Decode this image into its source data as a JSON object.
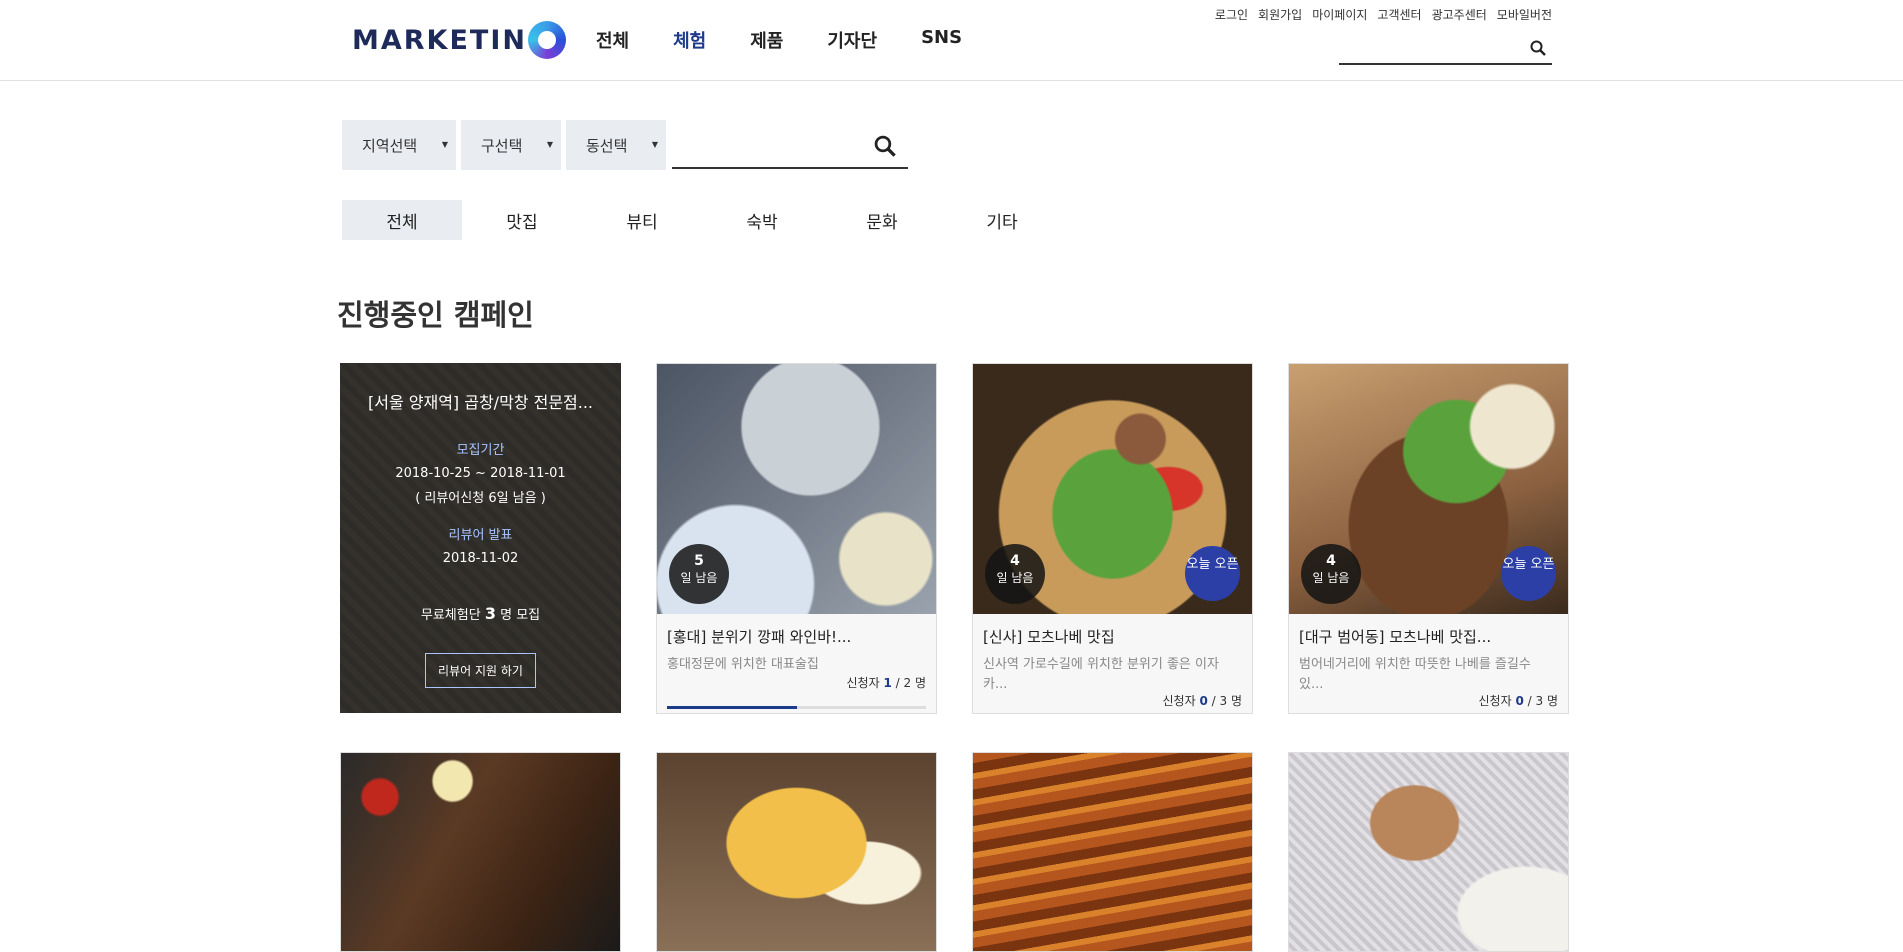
{
  "header": {
    "logo_text": "MARKETIN",
    "nav": [
      "전체",
      "체험",
      "제품",
      "기자단",
      "SNS"
    ],
    "util_links": [
      "로그인",
      "회원가입",
      "마이페이지",
      "고객센터",
      "광고주센터",
      "모바일버전"
    ],
    "search_placeholder": ""
  },
  "filter": {
    "region": "지역선택",
    "district": "구선택",
    "dong": "동선택",
    "search_placeholder": ""
  },
  "categories": [
    "전체",
    "맛집",
    "뷰티",
    "숙박",
    "문화",
    "기타"
  ],
  "section_title": "진행중인 캠페인",
  "featured": {
    "title": "[서울 양재역] 곱창/막창 전문점...",
    "period_label": "모집기간",
    "period": "2018-10-25 ~ 2018-11-01",
    "remain": "( 리뷰어신청 6일 남음 )",
    "announce_label": "리뷰어 발표",
    "announce_date": "2018-11-02",
    "recruit_prefix": "무료체험단",
    "recruit_count": "3",
    "recruit_suffix": "명 모집",
    "apply_label": "리뷰어 지원 하기"
  },
  "cards": [
    {
      "title": "[홍대] 분위기 깡패 와인바!...",
      "desc": "홍대정문에 위치한 대표술집",
      "applicant_label": "신청자",
      "applied": "1",
      "total": "/ 2 명",
      "progress": 0.5,
      "days_left": "5",
      "days_unit": "일 남음",
      "open_today": ""
    },
    {
      "title": "[신사] 모츠나베 맛집",
      "desc": "신사역 가로수길에 위치한 분위기 좋은 이자카...",
      "applicant_label": "신청자",
      "applied": "0",
      "total": "/ 3 명",
      "days_left": "4",
      "days_unit": "일 남음",
      "open_today": "오늘 오픈"
    },
    {
      "title": "[대구 범어동] 모츠나베 맛집...",
      "desc": "범어네거리에 위치한 따뜻한 나베를 즐길수 있...",
      "applicant_label": "신청자",
      "applied": "0",
      "total": "/ 3 명",
      "days_left": "4",
      "days_unit": "일 남음",
      "open_today": "오늘 오픈"
    }
  ]
}
